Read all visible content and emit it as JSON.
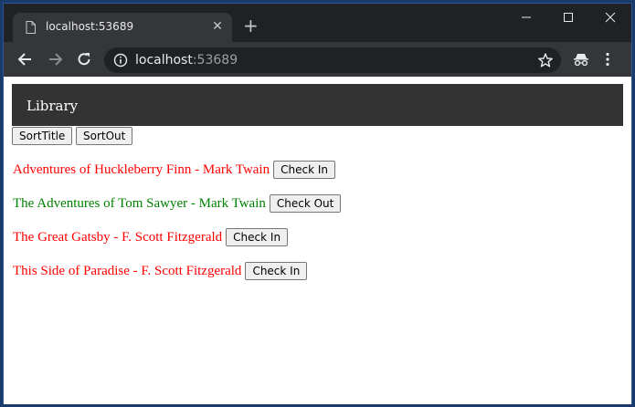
{
  "browser": {
    "tab_title": "localhost:53689",
    "url_host": "localhost",
    "url_port": ":53689"
  },
  "page": {
    "brand": "Library",
    "sort_buttons": {
      "sort_title": "SortTitle",
      "sort_out": "SortOut"
    },
    "books": [
      {
        "title": "Adventures of Huckleberry Finn - Mark Twain",
        "action": "Check In",
        "color": "#ff0000"
      },
      {
        "title": "The Adventures of Tom Sawyer - Mark Twain",
        "action": "Check Out",
        "color": "#008000"
      },
      {
        "title": "The Great Gatsby - F. Scott Fitzgerald",
        "action": "Check In",
        "color": "#ff0000"
      },
      {
        "title": "This Side of Paradise - F. Scott Fitzgerald",
        "action": "Check In",
        "color": "#ff0000"
      }
    ]
  }
}
